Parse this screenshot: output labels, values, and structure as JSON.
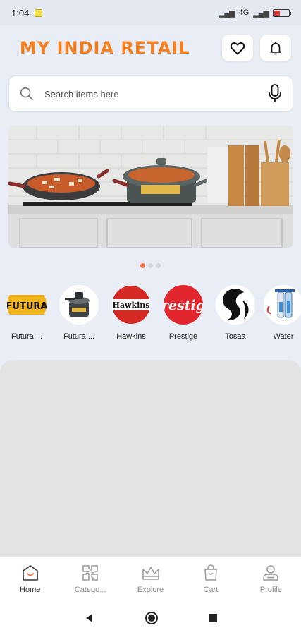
{
  "status_bar": {
    "time": "1:04",
    "network": "4G",
    "battery": "11"
  },
  "header": {
    "brand": "MY INDIA RETAIL"
  },
  "search": {
    "placeholder": "Search items here"
  },
  "carousel": {
    "pages": 3,
    "active_index": 0
  },
  "brands": [
    {
      "label": "Futura ...",
      "logo_text": "FUTURA"
    },
    {
      "label": "Futura ...",
      "logo_text": ""
    },
    {
      "label": "Hawkins",
      "logo_text": "Hawkins"
    },
    {
      "label": "Prestige",
      "logo_text": "restig"
    },
    {
      "label": "Tosaa",
      "logo_text": ""
    },
    {
      "label": "Water",
      "logo_text": ""
    }
  ],
  "bottom_nav": [
    {
      "label": "Home",
      "icon": "home-icon",
      "active": true
    },
    {
      "label": "Catego...",
      "icon": "category-icon",
      "active": false
    },
    {
      "label": "Explore",
      "icon": "explore-icon",
      "active": false
    },
    {
      "label": "Cart",
      "icon": "cart-icon",
      "active": false
    },
    {
      "label": "Profile",
      "icon": "profile-icon",
      "active": false
    }
  ],
  "colors": {
    "brand": "#f47e1e",
    "accent_dot": "#f4714a",
    "background": "#e9eef6"
  }
}
